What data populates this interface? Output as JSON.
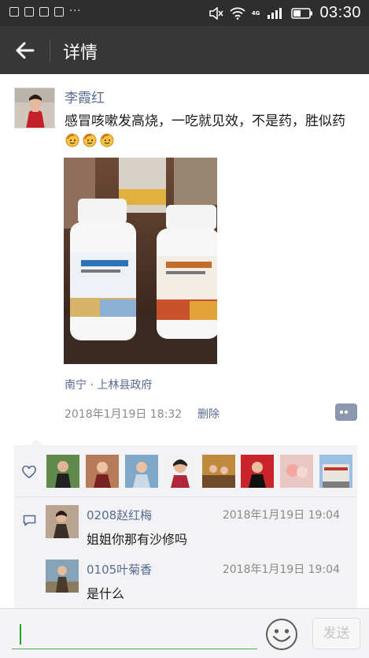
{
  "status_bar": {
    "network": "4G",
    "time": "03:30",
    "icons": [
      "photo-icon",
      "tag-icon",
      "app-icon",
      "gallery-icon",
      "more-dots-icon",
      "mute-icon",
      "wifi-icon",
      "signal-icon",
      "battery-icon"
    ]
  },
  "nav": {
    "title": "详情",
    "back_icon": "back-arrow-icon"
  },
  "post": {
    "author": "李霞红",
    "text": "感冒咳嗽发高烧，一吃就见效，不是药，胜似药",
    "emoji_count": 3,
    "emoji_icon": "strong-emoji-icon",
    "location": "南宁 · 上林县政府",
    "time": "2018年1月19日 18:32",
    "delete_label": "删除",
    "comment_icon": "comment-bubble-icon"
  },
  "likes": {
    "icon": "heart-icon",
    "count": 8
  },
  "comments": [
    {
      "name": "0208赵红梅",
      "time": "2018年1月19日 19:04",
      "text": "姐姐你那有沙修吗"
    },
    {
      "name": "0105叶菊香",
      "time": "2018年1月19日 19:04",
      "text": "是什么"
    }
  ],
  "input": {
    "value": "",
    "send_label": "发送",
    "emoji_icon": "smiley-icon"
  },
  "colors": {
    "nav_bg": "#373737",
    "status_bg": "#2e2e2e",
    "link": "#576b95",
    "accent_green": "#1aad19"
  }
}
